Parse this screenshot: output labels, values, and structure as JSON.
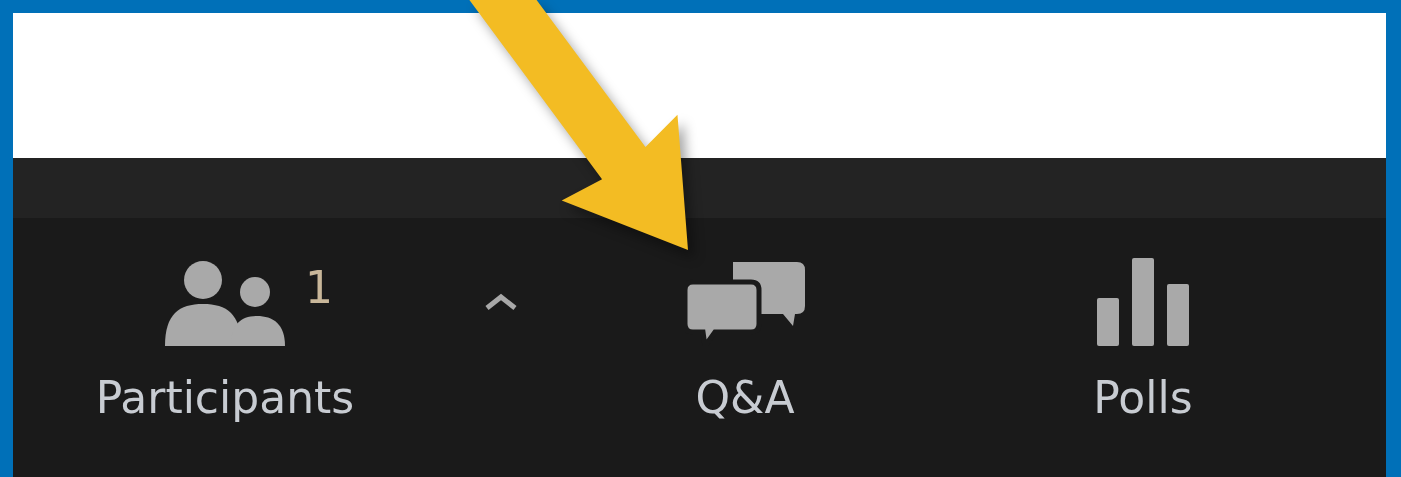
{
  "toolbar": {
    "items": [
      {
        "kind": "participants",
        "label": "Participants",
        "count": "1",
        "menu": true
      },
      {
        "kind": "qa",
        "label": "Q&A"
      },
      {
        "kind": "polls",
        "label": "Polls"
      }
    ]
  }
}
